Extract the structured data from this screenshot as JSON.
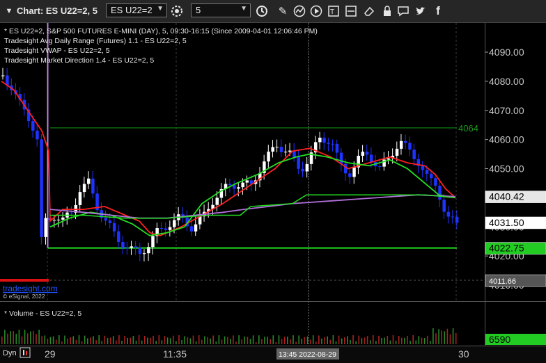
{
  "toolbar": {
    "title": "Chart: ES U22=2, 5",
    "symbol": "ES U22=2",
    "interval": "5"
  },
  "legend": {
    "line1": "* ES U22=2, S&P 500 FUTURES E-MINI (DAY), 5, 09:30-16:15 (Since 2009-04-01 12:06:46 PM)",
    "line2": "Tradesight Avg Daily Range (Futures) 1.1 - ES U22=2, 5",
    "line3": "Tradesight VWAP - ES U22=2, 5",
    "line4": "Tradesight Market Direction 1.4 - ES U22=2, 5"
  },
  "volume_pane": {
    "label": "* Volume - ES U22=2, 5"
  },
  "watermark": {
    "site": "tradesight.com",
    "copyright": "© eSignal, 2022"
  },
  "price_axis": {
    "ticks": [
      "4090.00",
      "4080.00",
      "4070.00",
      "4060.00",
      "4050.00",
      "4040.00",
      "4030.00",
      "4020.00",
      "4010.00"
    ]
  },
  "price_tags": [
    {
      "label": "4064",
      "price": 4064,
      "color": "#1d9a1d"
    },
    {
      "label": "4040.42",
      "price": 4040.42,
      "color": "#000000",
      "bg": "#e6e6e6"
    },
    {
      "label": "4031.50",
      "price": 4031.5,
      "color": "#000000",
      "bg": "#ffffff"
    },
    {
      "label": "4022.75",
      "price": 4022.75,
      "color": "#000000",
      "bg": "#22cc22"
    },
    {
      "label": "4011.66",
      "price": 4011.66,
      "color": "#ffffff",
      "bg": "#555555"
    }
  ],
  "volume_tag": {
    "label": "6590",
    "bg": "#22cc22"
  },
  "time_axis": {
    "labels": [
      "29",
      "11:35",
      "30"
    ],
    "crosshair": "13:45 2022-08-29",
    "dyn_label": "Dyn"
  },
  "colors": {
    "up": "#ffffff",
    "down": "#1f33ff",
    "ma_red": "#ff2020",
    "ma_green": "#22e022",
    "vwap": "#b070d8",
    "range": "#0f7a0f"
  }
}
